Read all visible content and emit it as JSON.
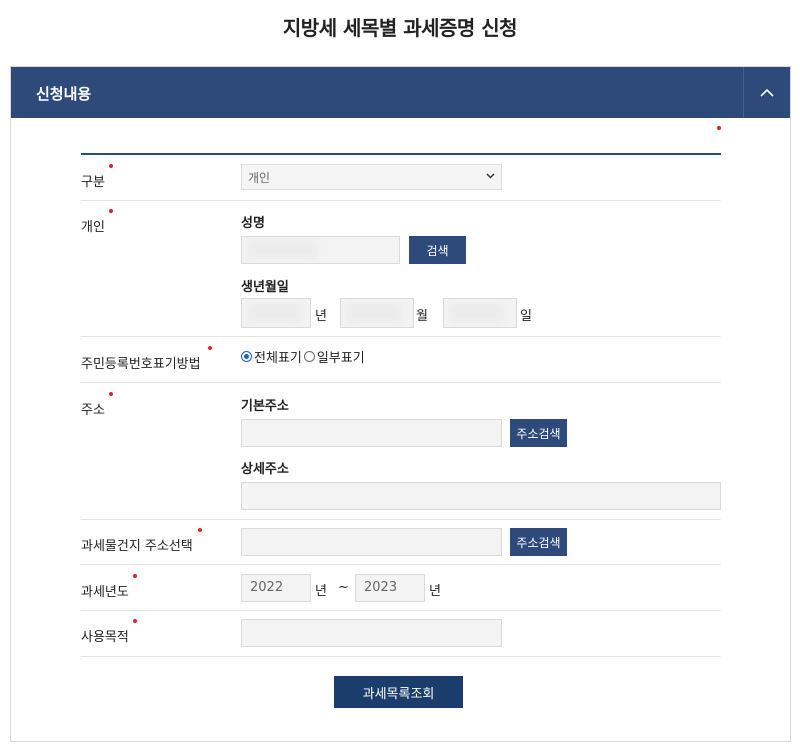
{
  "page": {
    "title": "지방세 세목별 과세증명 신청"
  },
  "panel": {
    "title": "신청내용"
  },
  "form": {
    "type": {
      "label": "구분",
      "selected": "개인"
    },
    "individual": {
      "label": "개인",
      "name_label": "성명",
      "search_label": "검색",
      "birth_label": "생년월일",
      "year_unit": "년",
      "month_unit": "월",
      "day_unit": "일"
    },
    "rrn_display": {
      "label": "주민등록번호표기방법",
      "options": [
        "전체표기",
        "일부표기"
      ],
      "selected": "전체표기"
    },
    "address": {
      "label": "주소",
      "basic_label": "기본주소",
      "detail_label": "상세주소",
      "search_label": "주소검색"
    },
    "property": {
      "label": "과세물건지 주소선택",
      "search_label": "주소검색"
    },
    "tax_year": {
      "label": "과세년도",
      "from": "2022",
      "to": "2023",
      "unit": "년",
      "separator": "~"
    },
    "purpose": {
      "label": "사용목적"
    },
    "submit_label": "과세목록조회"
  },
  "colors": {
    "header": "#2d4a7a",
    "button": "#2d4a7a",
    "submit": "#1b3d6b",
    "required": "#d9262c"
  }
}
